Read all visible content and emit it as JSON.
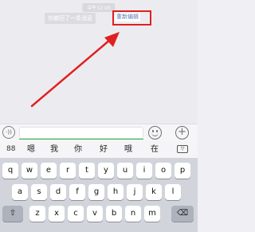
{
  "chat": {
    "timestamp": "中午12:00",
    "recall_notice": "你撤回了一条消息",
    "reedit_link": "重新编辑"
  },
  "input_bar": {
    "voice_icon": "voice-icon",
    "emoji_icon": "emoji-icon",
    "plus_icon": "plus-icon",
    "plus_glyph": "+",
    "voice_glyph": "·))"
  },
  "candidates": {
    "grid_glyph": "88",
    "items": [
      "嗯",
      "我",
      "你",
      "好",
      "哦",
      "在"
    ],
    "collapse_glyph": "▽"
  },
  "keys": {
    "row1": [
      "q",
      "w",
      "e",
      "r",
      "t",
      "y",
      "u",
      "i",
      "o",
      "p"
    ],
    "row2": [
      "a",
      "s",
      "d",
      "f",
      "g",
      "h",
      "j",
      "k",
      "l"
    ],
    "row3": [
      "z",
      "x",
      "c",
      "v",
      "b",
      "n",
      "m"
    ],
    "shift_glyph": "⇧",
    "delete_glyph": "⌫"
  },
  "colors": {
    "annotation_red": "#e02020",
    "link_blue": "#5e7db8",
    "input_underline_green": "#2bb44a"
  }
}
